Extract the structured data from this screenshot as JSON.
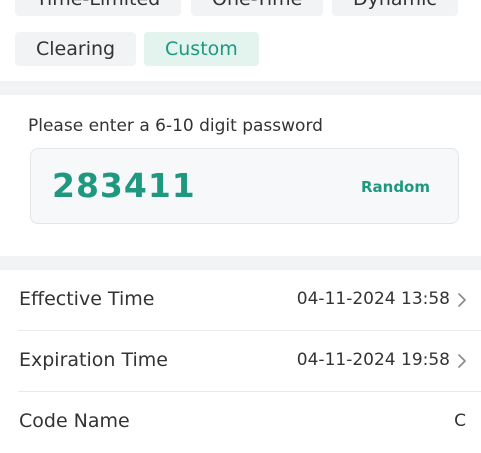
{
  "code_types": {
    "items": [
      {
        "label": "Time-Limited",
        "selected": false
      },
      {
        "label": "One-Time",
        "selected": false
      },
      {
        "label": "Dynamic",
        "selected": false
      },
      {
        "label": "Clearing",
        "selected": false
      },
      {
        "label": "Custom",
        "selected": true
      }
    ]
  },
  "password": {
    "hint": "Please enter a 6-10 digit password",
    "value": "283411",
    "random_label": "Random"
  },
  "settings": {
    "effective_time": {
      "label": "Effective Time",
      "value": "04-11-2024 13:58"
    },
    "expiration_time": {
      "label": "Expiration Time",
      "value": "04-11-2024 19:58"
    },
    "code_name": {
      "label": "Code Name",
      "value": "C"
    }
  },
  "colors": {
    "accent": "#1e9980",
    "selected_chip_bg": "#e3f4ef",
    "chip_bg": "#f2f3f5",
    "page_bg": "#f2f3f5",
    "card_bg": "#ffffff"
  },
  "icons": {
    "row_arrow": "chevron-right-icon"
  }
}
